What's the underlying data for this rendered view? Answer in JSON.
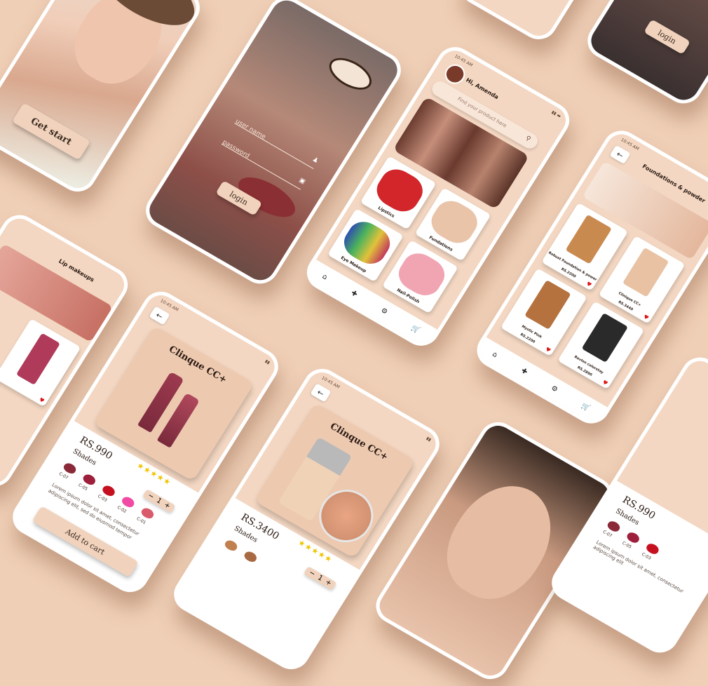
{
  "colors": {
    "background": "#efcfb6",
    "screen": "#f3d7c2",
    "button": "#f1d3bd"
  },
  "onboarding": {
    "button": "Get start"
  },
  "login": {
    "username_placeholder": "user name",
    "password_placeholder": "password",
    "button": "login"
  },
  "home": {
    "time": "10:45 AM",
    "greeting": "Hi, Amenda",
    "search_placeholder": "Find your product here",
    "categories": [
      "Lipstics",
      "Fundations",
      "Eye Makeup",
      "Nail-Polish"
    ]
  },
  "foundation": {
    "time": "10:45 AM",
    "title": "Foundations & powder",
    "products": [
      "Robust Foundation & power",
      "Clinique CC+",
      "Mystic Pink",
      "Revlon colorstay"
    ],
    "prices": [
      "RS.2200",
      "RS.3440",
      "RS.2200",
      "RS.2890"
    ]
  },
  "lip": {
    "title": "Lip makeups"
  },
  "product1": {
    "time": "10:45 AM",
    "title": "Clinque CC+",
    "price": "RS.990",
    "shades_label": "Shades",
    "shades": [
      "C-07",
      "C-05",
      "C-03",
      "C-02",
      "C-01"
    ],
    "qty": "1",
    "description": "Lorem ipsum dolor sit amet, consectetur adipiscing elit, sed do eiusmod tempor",
    "cta": "Add to cart"
  },
  "product2": {
    "time": "10:45 AM",
    "title": "Clinque CC+",
    "price": "RS.3400",
    "shades_label": "Shades",
    "qty": "1"
  },
  "product3": {
    "price": "RS.990",
    "shades_label": "Shades",
    "shades": [
      "C-07",
      "C-05",
      "C-03"
    ],
    "description": "Lorem ipsum dolor sit amet, consectetur adipiscing elit"
  },
  "icons": [
    "home-icon",
    "plus-icon",
    "bell-icon",
    "cart-icon",
    "search-icon",
    "user-icon",
    "lock-icon",
    "heart-icon",
    "back-arrow-icon"
  ]
}
